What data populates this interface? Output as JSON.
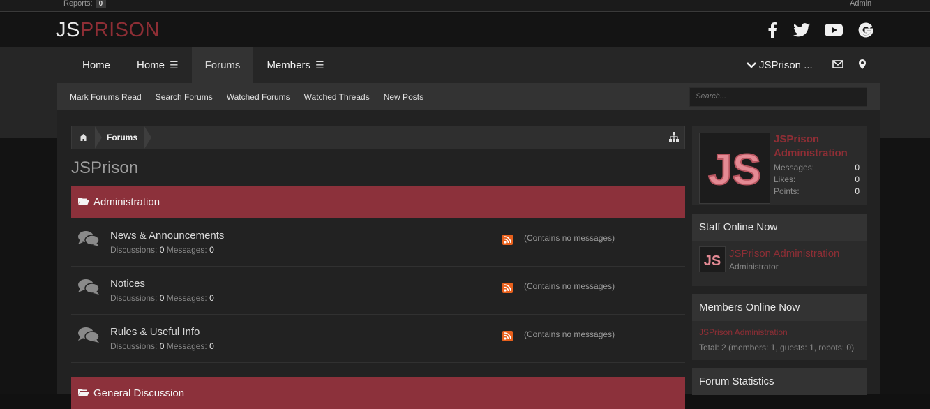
{
  "topbar": {
    "reports_label": "Reports:",
    "reports_count": "0",
    "admin_label": "Admin"
  },
  "logo": {
    "part1": "JS",
    "part2": "PRISON"
  },
  "social": [
    "facebook-icon",
    "twitter-icon",
    "youtube-icon",
    "google-icon"
  ],
  "nav": {
    "items": [
      {
        "label": "Home"
      },
      {
        "label": "Home"
      },
      {
        "label": "Forums"
      },
      {
        "label": "Members"
      }
    ],
    "user_label": "JSPrison ..."
  },
  "subnav": {
    "items": [
      "Mark Forums Read",
      "Search Forums",
      "Watched Forums",
      "Watched Threads",
      "New Posts"
    ],
    "search_placeholder": "Search..."
  },
  "breadcrumb": {
    "crumb": "Forums"
  },
  "page_title": "JSPrison",
  "categories": [
    {
      "title": "Administration"
    },
    {
      "title": "General Discussion"
    }
  ],
  "forums": [
    {
      "title": "News & Announcements",
      "discussions_label": "Discussions:",
      "discussions": "0",
      "messages_label": "Messages:",
      "messages": "0",
      "last": "(Contains no messages)"
    },
    {
      "title": "Notices",
      "discussions_label": "Discussions:",
      "discussions": "0",
      "messages_label": "Messages:",
      "messages": "0",
      "last": "(Contains no messages)"
    },
    {
      "title": "Rules & Useful Info",
      "discussions_label": "Discussions:",
      "discussions": "0",
      "messages_label": "Messages:",
      "messages": "0",
      "last": "(Contains no messages)"
    }
  ],
  "sidebar": {
    "profile": {
      "name": "JSPrison Administration",
      "avatar_text": "JS",
      "stats": [
        {
          "label": "Messages:",
          "value": "0"
        },
        {
          "label": "Likes:",
          "value": "0"
        },
        {
          "label": "Points:",
          "value": "0"
        }
      ]
    },
    "staff": {
      "title": "Staff Online Now",
      "name": "JSPrison Administration",
      "role": "Administrator",
      "avatar_text": "JS"
    },
    "members": {
      "title": "Members Online Now",
      "name": "JSPrison Administration",
      "total": "Total: 2 (members: 1, guests: 1, robots: 0)"
    },
    "stats": {
      "title": "Forum Statistics"
    }
  },
  "colors": {
    "accent": "#8c313b",
    "rss": "#e8601c"
  }
}
